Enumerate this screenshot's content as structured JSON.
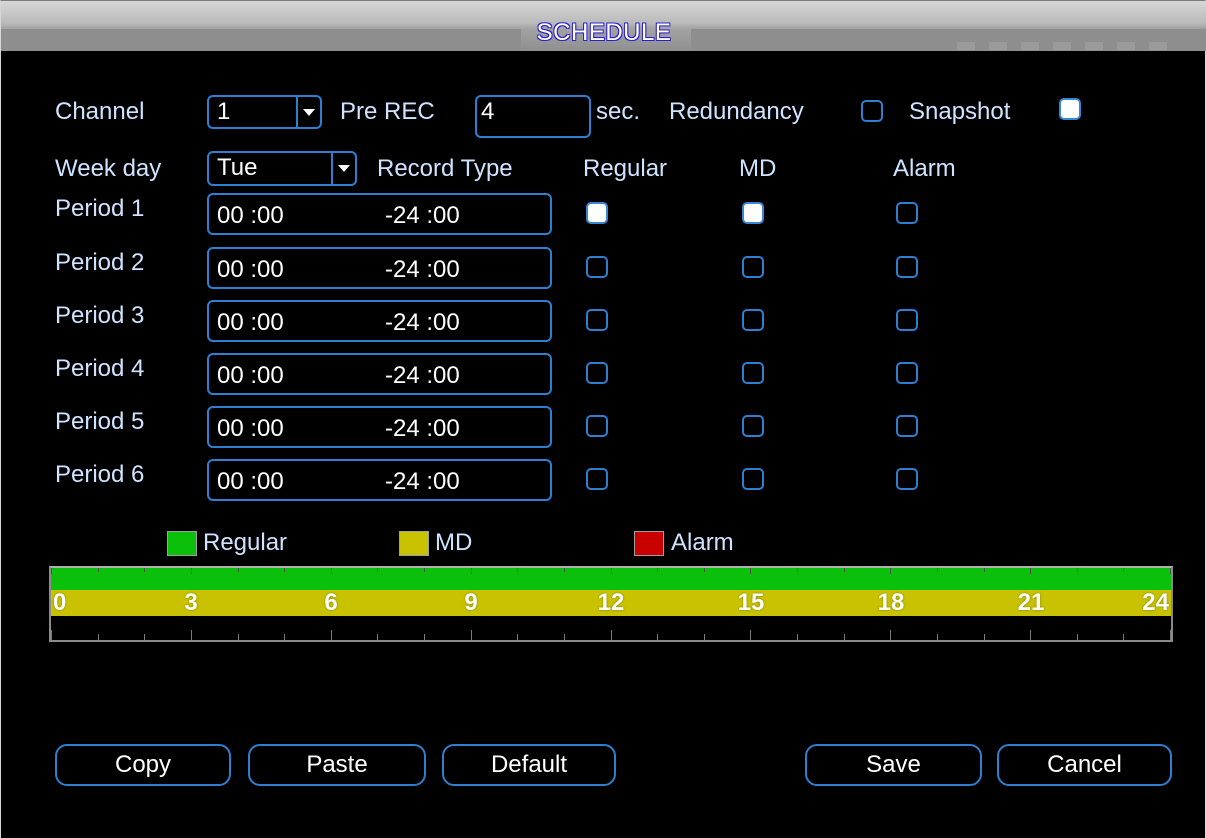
{
  "window": {
    "title": "SCHEDULE"
  },
  "top_row": {
    "channel_label": "Channel",
    "channel_value": "1",
    "prerec_label": "Pre REC",
    "prerec_value": "4",
    "sec_label": "sec.",
    "redundancy_label": "Redundancy",
    "redundancy_checked": false,
    "snapshot_label": "Snapshot",
    "snapshot_checked": true
  },
  "second_row": {
    "weekday_label": "Week day",
    "weekday_value": "Tue",
    "record_type_label": "Record Type",
    "col_regular": "Regular",
    "col_md": "MD",
    "col_alarm": "Alarm"
  },
  "periods": [
    {
      "label": "Period 1",
      "start": "00 :00",
      "end": "-24 :00",
      "regular": true,
      "md": true,
      "alarm": false
    },
    {
      "label": "Period 2",
      "start": "00 :00",
      "end": "-24 :00",
      "regular": false,
      "md": false,
      "alarm": false
    },
    {
      "label": "Period 3",
      "start": "00 :00",
      "end": "-24 :00",
      "regular": false,
      "md": false,
      "alarm": false
    },
    {
      "label": "Period 4",
      "start": "00 :00",
      "end": "-24 :00",
      "regular": false,
      "md": false,
      "alarm": false
    },
    {
      "label": "Period 5",
      "start": "00 :00",
      "end": "-24 :00",
      "regular": false,
      "md": false,
      "alarm": false
    },
    {
      "label": "Period 6",
      "start": "00 :00",
      "end": "-24 :00",
      "regular": false,
      "md": false,
      "alarm": false
    }
  ],
  "legend": [
    {
      "label": "Regular",
      "color": "#0bc00b"
    },
    {
      "label": "MD",
      "color": "#c8c200"
    },
    {
      "label": "Alarm",
      "color": "#c80000"
    }
  ],
  "timeline": {
    "hours": [
      "0",
      "3",
      "6",
      "9",
      "12",
      "15",
      "18",
      "21",
      "24"
    ],
    "regular_color": "#0bc00b",
    "md_color": "#c8c200"
  },
  "buttons": {
    "copy": "Copy",
    "paste": "Paste",
    "default": "Default",
    "save": "Save",
    "cancel": "Cancel"
  }
}
